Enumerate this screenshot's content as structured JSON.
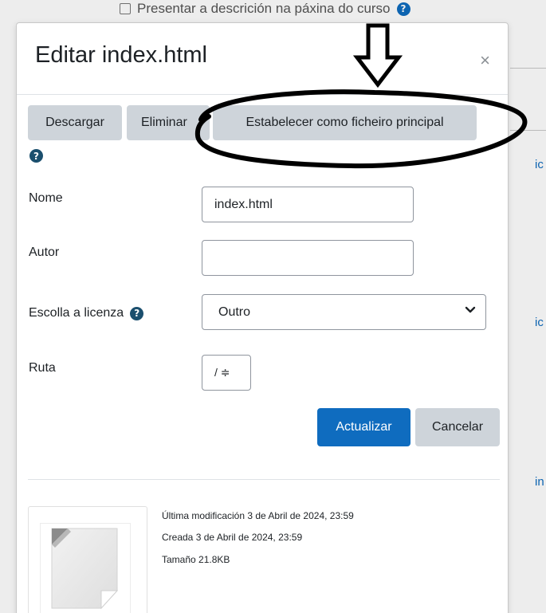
{
  "background": {
    "checkbox_label": "Presentar a descrición na páxina do curso",
    "help_glyph": "?",
    "side_links": [
      "ic",
      "ic",
      "in"
    ]
  },
  "modal": {
    "title": "Editar index.html",
    "close": "×"
  },
  "actions": {
    "download": "Descargar",
    "delete": "Eliminar",
    "set_main": "Estabelecer como ficheiro principal",
    "help_glyph": "?"
  },
  "form": {
    "name_label": "Nome",
    "name_value": "index.html",
    "author_label": "Autor",
    "author_value": "",
    "license_label": "Escolla a licenza",
    "license_help_glyph": "?",
    "license_value": "Outro",
    "path_label": "Ruta",
    "path_value": "/ ≑",
    "update_button": "Actualizar",
    "cancel_button": "Cancelar"
  },
  "file_info": {
    "modified": "Última modificación  3 de Abril de 2024, 23:59",
    "created": "Creada  3 de Abril de 2024, 23:59",
    "size": "Tamaño  21.8KB"
  },
  "icons": {
    "close": "close-icon",
    "help": "help-circle-icon",
    "chevron": "chevron-down-icon",
    "file_thumbnail": "file-icon",
    "annotation_arrow": "down-arrow-annotation",
    "annotation_ellipse": "ellipse-annotation"
  },
  "colors": {
    "primary": "#0f6cbf",
    "secondary_button": "#ced4da",
    "help_icon": "#1b4f6e",
    "annotation": "#000000"
  }
}
